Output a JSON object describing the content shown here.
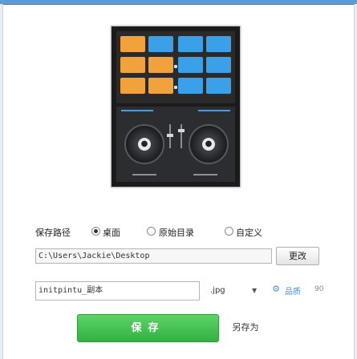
{
  "preview_image": {
    "center_logo_left": "●",
    "center_logo_right": "●"
  },
  "save_location": {
    "label": "保存路径",
    "options": [
      {
        "label": "桌面",
        "selected": true
      },
      {
        "label": "原始目录",
        "selected": false
      },
      {
        "label": "自定义",
        "selected": false
      }
    ],
    "path_value": "C:\\Users\\Jackie\\Desktop",
    "change_button": "更改"
  },
  "file": {
    "name_value": "initpintu_副本",
    "format_value": ".jpg",
    "format_arrow": "▼",
    "quality_icon": "gear-icon",
    "quality_label": "品质",
    "quality_value": "90"
  },
  "actions": {
    "save": "保存",
    "save_as": "另存为"
  },
  "colors": {
    "accent": "#3aa0e8",
    "save_button": "#31b040"
  }
}
